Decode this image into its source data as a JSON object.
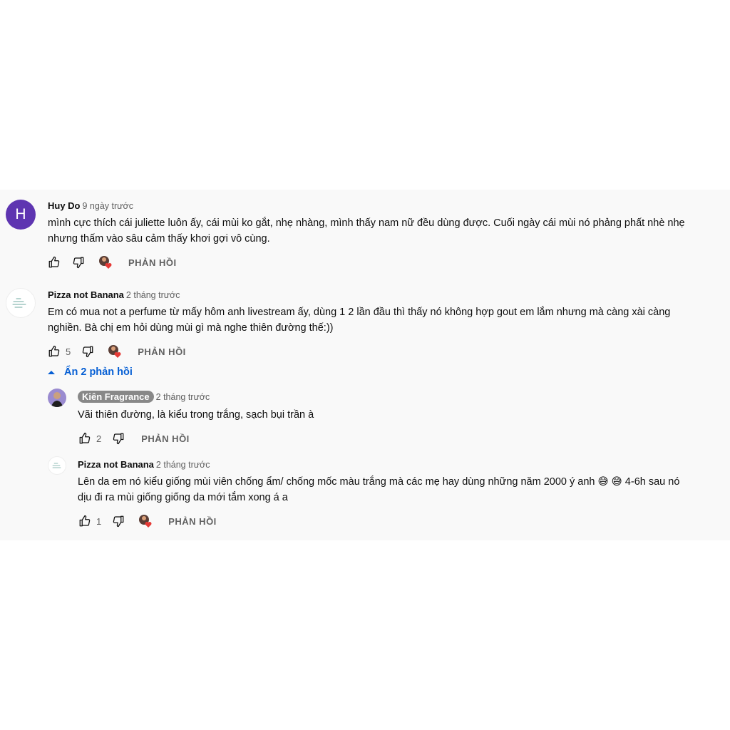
{
  "comments": [
    {
      "avatar_letter": "H",
      "author": "Huy Do",
      "time": "9 ngày trước",
      "text_lines": [
        "mình cực thích cái juliette luôn ấy, cái mùi ko gắt, nhẹ nhàng, mình thấy nam nữ đều dùng được. Cuối ngày cái mùi nó phảng phất nhè nhẹ",
        "nhưng thấm vào sâu cảm thấy khơi gợi vô cùng."
      ],
      "likes": "",
      "reply_label": "PHẢN HỒI"
    },
    {
      "author": "Pizza not Banana",
      "time": "2 tháng trước",
      "text_lines": [
        "Em có mua not a perfume từ mấy hôm anh livestream ấy, dùng 1 2 lần đầu thì thấy nó không hợp gout em lắm nhưng mà càng xài càng",
        "nghiền. Bà chị em hỏi dùng mùi gì mà nghe thiên đường thế:))"
      ],
      "likes": "5",
      "reply_label": "PHẢN HỒI"
    }
  ],
  "replies_toggle": "Ẩn 2 phản hồi",
  "replies": [
    {
      "author": "Kiên Fragrance",
      "time": "2 tháng trước",
      "text_lines": [
        "Vãi thiên đường, là kiểu trong trắng, sạch bụi trần à"
      ],
      "likes": "2",
      "reply_label": "PHẢN HỒI"
    },
    {
      "author": "Pizza not Banana",
      "time": "2 tháng trước",
      "text_lines": [
        "Lên da em nó kiểu giống mùi viên chống ẩm/ chống mốc màu trắng mà các mẹ hay dùng những năm 2000 ý anh 😅 😅  4-6h sau nó",
        "dịu đi ra mùi giống giống da mới tắm xong á a"
      ],
      "likes": "1",
      "reply_label": "PHẢN HỒI"
    }
  ],
  "colors": {
    "panel_bg": "#f9f9f9",
    "link_blue": "#065fd4",
    "avatar_purple": "#5e35b1",
    "heart_red": "#e53935"
  },
  "icons": [
    "thumb-up-icon",
    "thumb-down-icon",
    "creator-heart-icon",
    "caret-up-icon"
  ]
}
